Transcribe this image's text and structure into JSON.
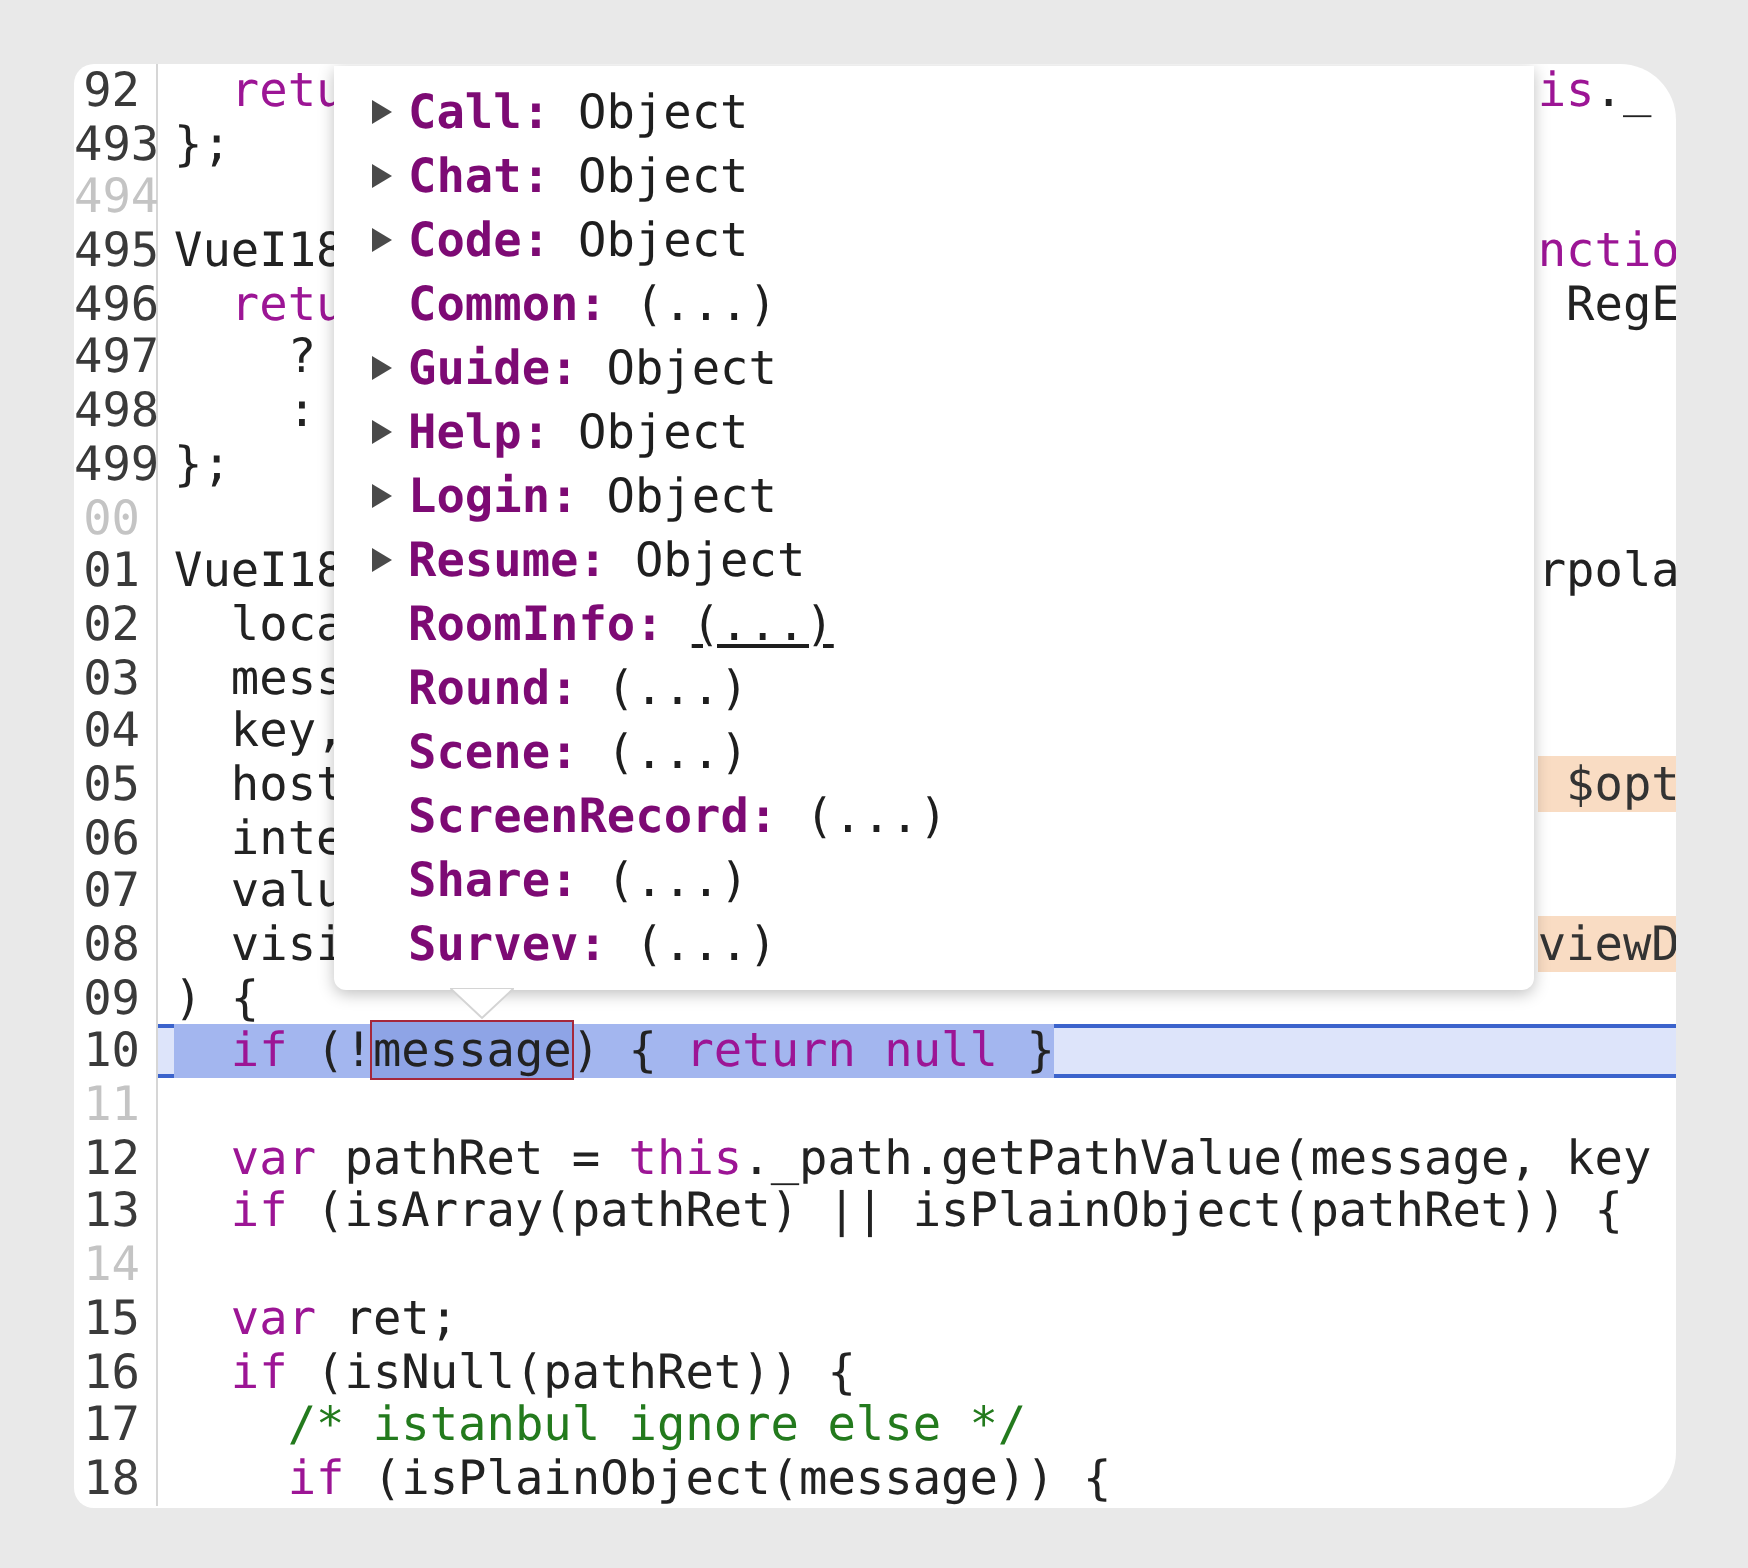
{
  "editor": {
    "lines": [
      {
        "number": "92",
        "selected": false,
        "left": [
          {
            "text": "  retu",
            "kind": "keyword"
          }
        ],
        "right": [
          {
            "text": "is",
            "kind": "keyword"
          },
          {
            "text": "._",
            "kind": "plain"
          }
        ]
      },
      {
        "number": "493",
        "selected": false,
        "left": [
          {
            "text": "};",
            "kind": "plain"
          }
        ]
      },
      {
        "number": "494",
        "selected": false
      },
      {
        "number": "495",
        "selected": false,
        "left": [
          {
            "text": "VueI18",
            "kind": "plain"
          }
        ],
        "right": [
          {
            "text": "nctio",
            "kind": "keyword"
          }
        ]
      },
      {
        "number": "496",
        "selected": false,
        "left": [
          {
            "text": "  retu",
            "kind": "keyword"
          }
        ],
        "right": [
          {
            "text": " RegE",
            "kind": "plain"
          }
        ]
      },
      {
        "number": "497",
        "selected": false,
        "left": [
          {
            "text": "    ?",
            "kind": "plain"
          }
        ]
      },
      {
        "number": "498",
        "selected": false,
        "left": [
          {
            "text": "    :",
            "kind": "plain"
          }
        ]
      },
      {
        "number": "499",
        "selected": false,
        "left": [
          {
            "text": "};",
            "kind": "plain"
          }
        ]
      },
      {
        "number": "00",
        "selected": false
      },
      {
        "number": "01",
        "selected": false,
        "left": [
          {
            "text": "VueI18",
            "kind": "plain"
          }
        ],
        "right": [
          {
            "text": "rpola",
            "kind": "plain"
          }
        ]
      },
      {
        "number": "02",
        "selected": false,
        "left": [
          {
            "text": "  loca",
            "kind": "plain"
          }
        ]
      },
      {
        "number": "03",
        "selected": false,
        "left": [
          {
            "text": "  mess",
            "kind": "plain"
          }
        ]
      },
      {
        "number": "04",
        "selected": false,
        "left": [
          {
            "text": "  key,",
            "kind": "plain"
          }
        ]
      },
      {
        "number": "05",
        "selected": false,
        "left": [
          {
            "text": "  host",
            "kind": "plain"
          }
        ],
        "right": [
          {
            "text": " $opt",
            "kind": "highlight"
          }
        ]
      },
      {
        "number": "06",
        "selected": false,
        "left": [
          {
            "text": "  inte",
            "kind": "plain"
          }
        ]
      },
      {
        "number": "07",
        "selected": false,
        "left": [
          {
            "text": "  valu",
            "kind": "plain"
          }
        ]
      },
      {
        "number": "08",
        "selected": false,
        "left": [
          {
            "text": "  visi",
            "kind": "plain"
          }
        ],
        "right": [
          {
            "text": "viewD",
            "kind": "highlight"
          }
        ]
      },
      {
        "number": "09",
        "selected": false,
        "left": [
          {
            "text": ") {",
            "kind": "plain"
          }
        ]
      },
      {
        "number": "10",
        "selected": true,
        "left": [
          {
            "text": "  if",
            "kind": "keyword"
          },
          {
            "text": " (!",
            "kind": "plain"
          },
          {
            "text": "message",
            "kind": "hovered"
          },
          {
            "text": ") { ",
            "kind": "plain"
          },
          {
            "text": "return null",
            "kind": "keyword"
          },
          {
            "text": " }",
            "kind": "plain"
          }
        ]
      },
      {
        "number": "11",
        "selected": false
      },
      {
        "number": "12",
        "selected": false,
        "left": [
          {
            "text": "  var",
            "kind": "keyword"
          },
          {
            "text": " pathRet = ",
            "kind": "plain"
          },
          {
            "text": "this",
            "kind": "keyword"
          },
          {
            "text": "._path.getPathValue(message, key",
            "kind": "plain"
          }
        ]
      },
      {
        "number": "13",
        "selected": false,
        "left": [
          {
            "text": "  if",
            "kind": "keyword"
          },
          {
            "text": " (isArray(pathRet) || isPlainObject(pathRet)) {",
            "kind": "plain"
          }
        ]
      },
      {
        "number": "14",
        "selected": false
      },
      {
        "number": "15",
        "selected": false,
        "left": [
          {
            "text": "  var",
            "kind": "keyword"
          },
          {
            "text": " ret;",
            "kind": "plain"
          }
        ]
      },
      {
        "number": "16",
        "selected": false,
        "left": [
          {
            "text": "  if",
            "kind": "keyword"
          },
          {
            "text": " (isNull(pathRet)) {",
            "kind": "plain"
          }
        ]
      },
      {
        "number": "17",
        "selected": false,
        "left": [
          {
            "text": "    /* istanbul ignore else */",
            "kind": "comment"
          }
        ]
      },
      {
        "number": "18",
        "selected": false,
        "left": [
          {
            "text": "    if",
            "kind": "keyword"
          },
          {
            "text": " (isPlainObject(message)) {",
            "kind": "plain"
          }
        ]
      }
    ]
  },
  "popup": {
    "items": [
      {
        "name": "Call:",
        "value": "Object",
        "expandable": true,
        "hovered": false
      },
      {
        "name": "Chat:",
        "value": "Object",
        "expandable": true,
        "hovered": false
      },
      {
        "name": "Code:",
        "value": "Object",
        "expandable": true,
        "hovered": false
      },
      {
        "name": "Common:",
        "value": "(...)",
        "expandable": false,
        "hovered": false
      },
      {
        "name": "Guide:",
        "value": "Object",
        "expandable": true,
        "hovered": false
      },
      {
        "name": "Help:",
        "value": "Object",
        "expandable": true,
        "hovered": false
      },
      {
        "name": "Login:",
        "value": "Object",
        "expandable": true,
        "hovered": false
      },
      {
        "name": "Resume:",
        "value": "Object",
        "expandable": true,
        "hovered": false
      },
      {
        "name": "RoomInfo:",
        "value": "(...)",
        "expandable": false,
        "hovered": true
      },
      {
        "name": "Round:",
        "value": "(...)",
        "expandable": false,
        "hovered": false
      },
      {
        "name": "Scene:",
        "value": "(...)",
        "expandable": false,
        "hovered": false
      },
      {
        "name": "ScreenRecord:",
        "value": "(...)",
        "expandable": false,
        "hovered": false
      },
      {
        "name": "Share:",
        "value": "(...)",
        "expandable": false,
        "hovered": false
      },
      {
        "name": "Survev:",
        "value": "(...)",
        "expandable": false,
        "hovered": false
      }
    ]
  }
}
